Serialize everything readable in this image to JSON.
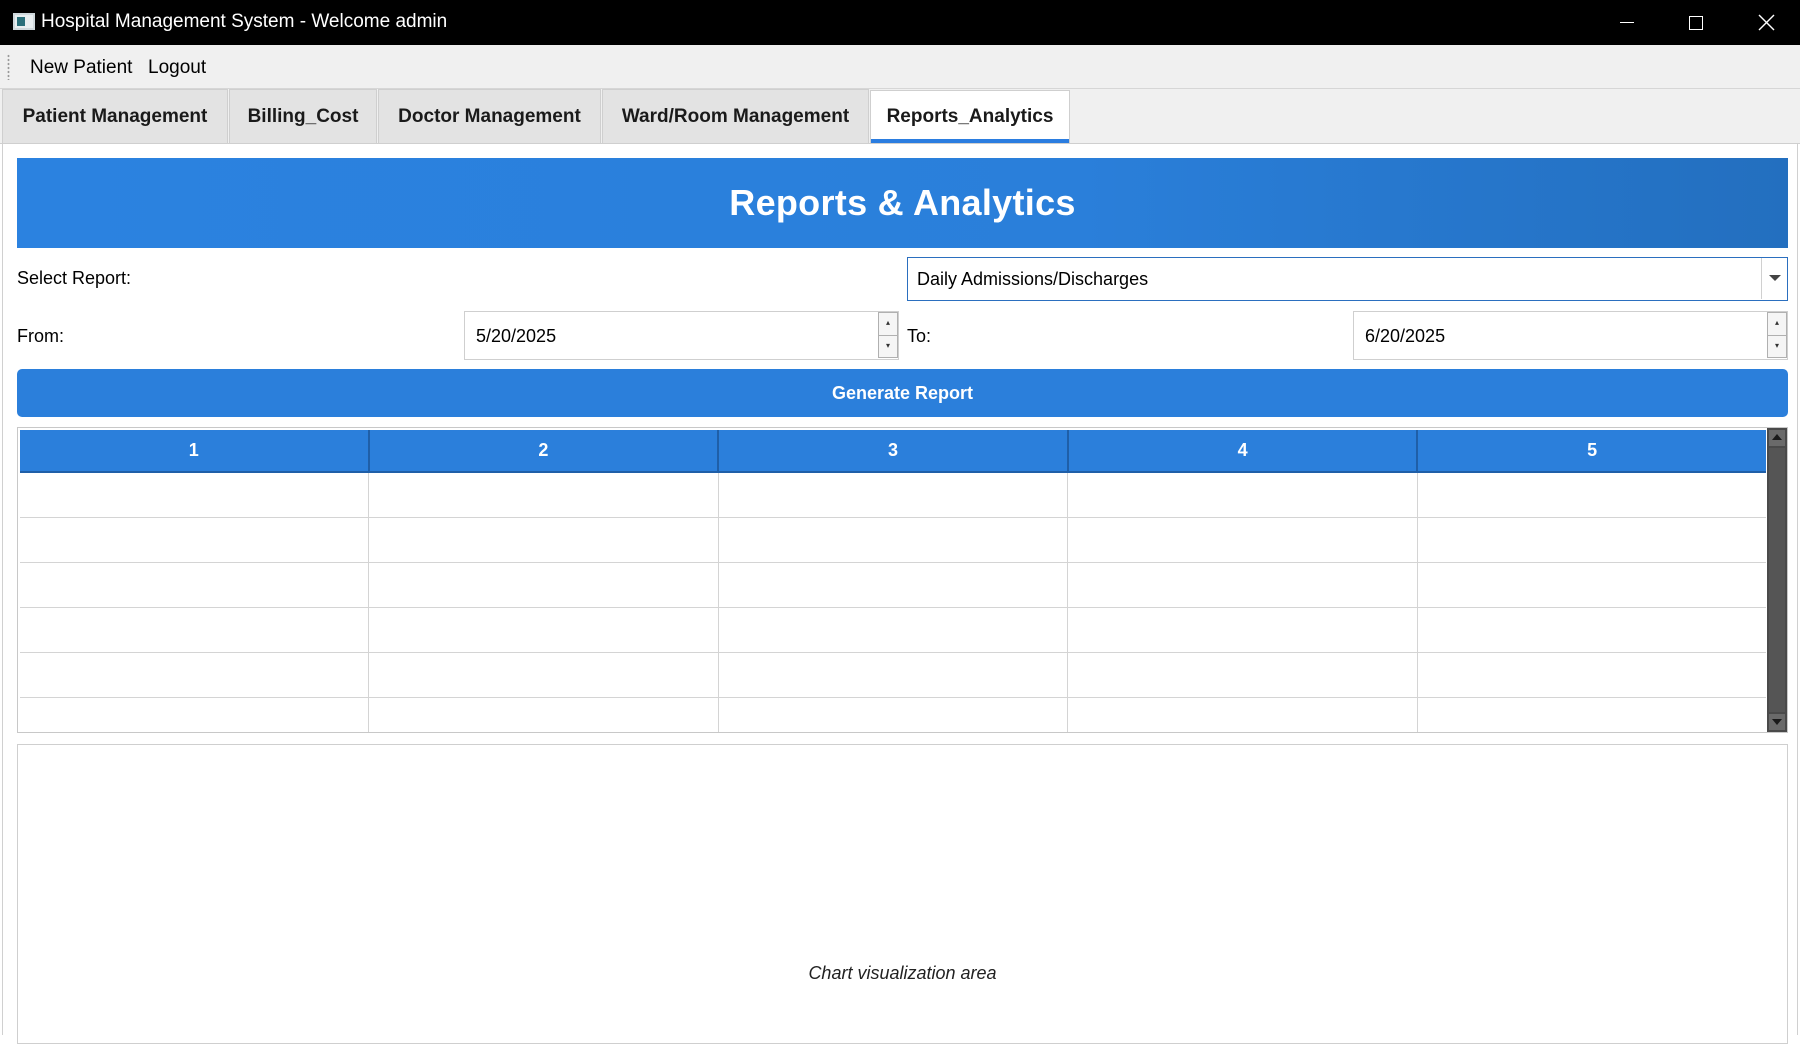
{
  "window": {
    "title": "Hospital Management System - Welcome admin",
    "icon": "app-window-icon"
  },
  "menu": {
    "items": [
      "New Patient",
      "Logout"
    ]
  },
  "tabs": [
    {
      "label": "Patient Management",
      "active": false
    },
    {
      "label": "Billing_Cost",
      "active": false
    },
    {
      "label": "Doctor Management",
      "active": false
    },
    {
      "label": "Ward/Room Management",
      "active": false
    },
    {
      "label": "Reports_Analytics",
      "active": true
    }
  ],
  "header": {
    "title": "Reports & Analytics"
  },
  "form": {
    "select_label": "Select Report:",
    "select_value": "Daily Admissions/Discharges",
    "from_label": "From:",
    "from_value": "5/20/2025",
    "to_label": "To:",
    "to_value": "6/20/2025",
    "generate_label": "Generate Report"
  },
  "grid": {
    "columns": [
      "1",
      "2",
      "3",
      "4",
      "5"
    ],
    "rows": [
      [
        "",
        "",
        "",
        "",
        ""
      ],
      [
        "",
        "",
        "",
        "",
        ""
      ],
      [
        "",
        "",
        "",
        "",
        ""
      ],
      [
        "",
        "",
        "",
        "",
        ""
      ],
      [
        "",
        "",
        "",
        "",
        ""
      ],
      [
        "",
        "",
        "",
        "",
        ""
      ]
    ]
  },
  "chart": {
    "placeholder": "Chart visualization area"
  },
  "colors": {
    "accent": "#2b7fdb",
    "titlebar": "#000000"
  }
}
